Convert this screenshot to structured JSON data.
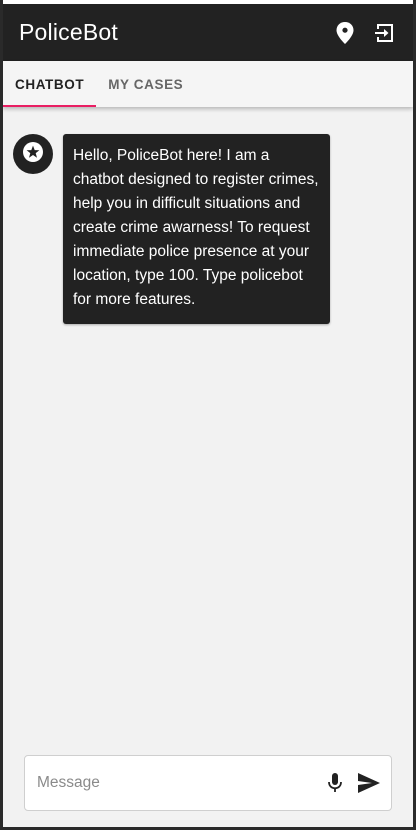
{
  "appbar": {
    "title": "PoliceBot",
    "icons": [
      "location-pin-icon",
      "logout-icon"
    ]
  },
  "tabs": [
    {
      "label": "CHATBOT",
      "active": true
    },
    {
      "label": "MY CASES",
      "active": false
    }
  ],
  "chat": {
    "messages": [
      {
        "sender_icon": "star-badge-icon",
        "text": "Hello, PoliceBot here! I am a chatbot designed to register crimes, help you in difficult situations and create crime awarness! To request immediate police presence at your location, type 100. Type policebot for more features."
      }
    ]
  },
  "composer": {
    "placeholder": "Message",
    "value": "",
    "icons": [
      "microphone-icon",
      "send-icon"
    ]
  },
  "colors": {
    "appbar_bg": "#222222",
    "tab_indicator": "#e91e63",
    "bubble_bg": "#222222",
    "background": "#f2f2f2"
  }
}
